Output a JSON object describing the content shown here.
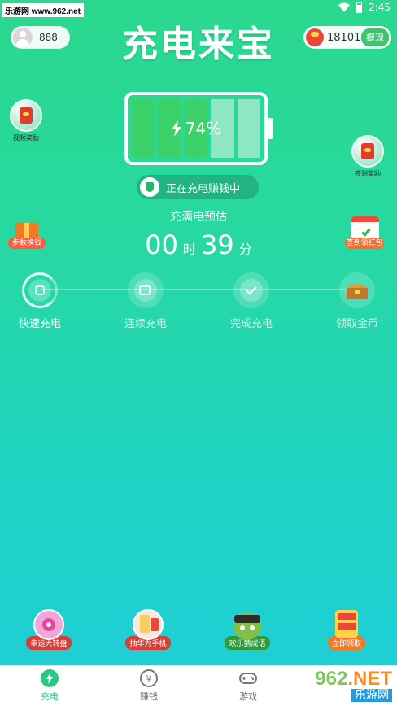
{
  "status_bar": {
    "watermark": "乐游网 www.962.net",
    "time": "2:45"
  },
  "header": {
    "user_score": "888",
    "title": "充电来宝",
    "coins": "18101",
    "withdraw_label": "提现"
  },
  "side_buttons": {
    "video_reward": "视频奖励",
    "sign_reward": "签到奖励",
    "steps_exchange": "步数换钱",
    "sign_red_packet": "签到领红包"
  },
  "battery": {
    "percent_text": "74%",
    "percent": 74,
    "cells_total": 5,
    "cells_full": 3
  },
  "charging_status": "正在充电赚钱中",
  "estimate": {
    "label": "充满电预估",
    "hours": "00",
    "hours_unit": "时",
    "minutes": "39",
    "minutes_unit": "分"
  },
  "steps": [
    {
      "label": "快速充电"
    },
    {
      "label": "连续充电"
    },
    {
      "label": "完成充电"
    },
    {
      "label": "领取金币"
    }
  ],
  "promos": [
    {
      "label": "幸运大转盘"
    },
    {
      "label": "抽华为手机"
    },
    {
      "label": "欢乐猜成语"
    },
    {
      "label": "立即领取"
    }
  ],
  "tabs": [
    {
      "label": "充电",
      "icon": "bolt-icon"
    },
    {
      "label": "赚钱",
      "icon": "yuan-icon"
    },
    {
      "label": "游戏",
      "icon": "gamepad-icon"
    }
  ],
  "bottom_watermark": {
    "logo_a": "962",
    "logo_b": ".NET",
    "sub": "乐游网"
  },
  "colors": {
    "accent": "#27c985",
    "bg_top": "#2bd88e",
    "bg_bottom": "#1fcfd6"
  }
}
